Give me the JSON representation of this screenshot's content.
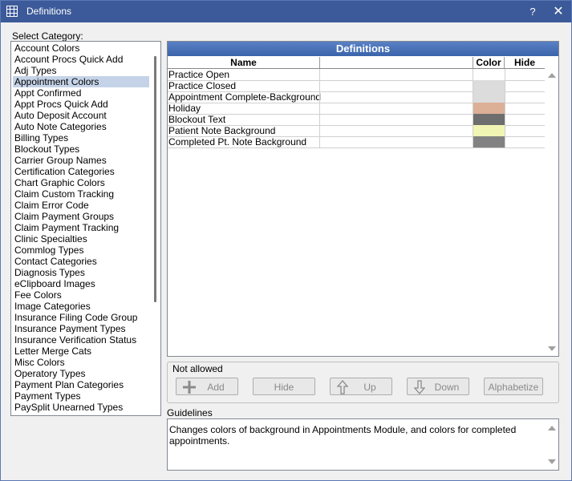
{
  "window": {
    "title": "Definitions",
    "help": "?",
    "close": "✕"
  },
  "category_label": "Select Category:",
  "categories": [
    "Account Colors",
    "Account Procs Quick Add",
    "Adj Types",
    "Appointment Colors",
    "Appt Confirmed",
    "Appt Procs Quick Add",
    "Auto Deposit Account",
    "Auto Note Categories",
    "Billing Types",
    "Blockout Types",
    "Carrier Group Names",
    "Certification Categories",
    "Chart Graphic Colors",
    "Claim Custom Tracking",
    "Claim Error Code",
    "Claim Payment Groups",
    "Claim Payment Tracking",
    "Clinic Specialties",
    "Commlog Types",
    "Contact Categories",
    "Diagnosis Types",
    "eClipboard Images",
    "Fee Colors",
    "Image Categories",
    "Insurance Filing Code Group",
    "Insurance Payment Types",
    "Insurance Verification Status",
    "Letter Merge Cats",
    "Misc Colors",
    "Operatory Types",
    "Payment Plan Categories",
    "Payment Types",
    "PaySplit Unearned Types"
  ],
  "selected_category": "Appointment Colors",
  "definitions": {
    "title": "Definitions",
    "columns": {
      "name": "Name",
      "color": "Color",
      "hide": "Hide"
    },
    "rows": [
      {
        "name": "Practice Open",
        "color": "#ffffff"
      },
      {
        "name": "Practice Closed",
        "color": "#dcdcdc"
      },
      {
        "name": "Appointment Complete-Background",
        "color": "#dcdcdc"
      },
      {
        "name": "Holiday",
        "color": "#dcb096"
      },
      {
        "name": "Blockout Text",
        "color": "#6e6e6e"
      },
      {
        "name": "Patient Note Background",
        "color": "#f0f5b4"
      },
      {
        "name": "Completed Pt. Note Background",
        "color": "#828282"
      }
    ]
  },
  "not_allowed": "Not allowed",
  "buttons": {
    "add": "Add",
    "hide": "Hide",
    "up": "Up",
    "down": "Down",
    "alphabetize": "Alphabetize"
  },
  "guidelines_label": "Guidelines",
  "guidelines_text": "Changes colors of background in Appointments Module, and colors for completed appointments."
}
